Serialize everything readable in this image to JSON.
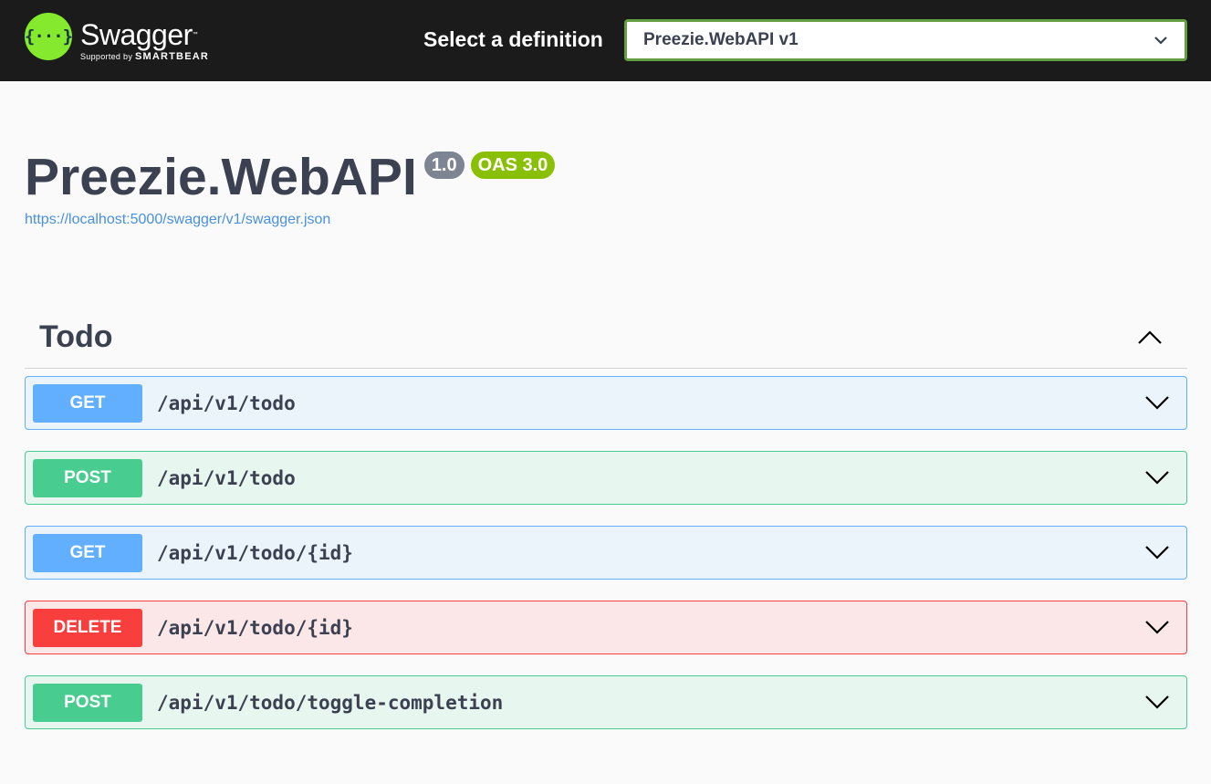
{
  "topbar": {
    "logo_name": "Swagger",
    "logo_trademark": "™",
    "logo_supported": "Supported by",
    "logo_company": "SMARTBEAR",
    "logo_glyph": "{···}",
    "definition_label": "Select a definition",
    "definition_selected": "Preezie.WebAPI v1"
  },
  "info": {
    "title": "Preezie.WebAPI",
    "version": "1.0",
    "oas": "OAS 3.0",
    "spec_url": "https://localhost:5000/swagger/v1/swagger.json"
  },
  "tag": {
    "name": "Todo",
    "expanded_icon": "chevron-up-icon"
  },
  "operations": [
    {
      "method": "GET",
      "path": "/api/v1/todo"
    },
    {
      "method": "POST",
      "path": "/api/v1/todo"
    },
    {
      "method": "GET",
      "path": "/api/v1/todo/{id}"
    },
    {
      "method": "DELETE",
      "path": "/api/v1/todo/{id}"
    },
    {
      "method": "POST",
      "path": "/api/v1/todo/toggle-completion"
    }
  ],
  "colors": {
    "topbar_bg": "#1b1b1b",
    "logo_green": "#85ea2d",
    "get": "#61affe",
    "post": "#49cc90",
    "delete": "#f93e3e",
    "badge_version": "#7d8492",
    "badge_oas": "#89bf04",
    "link": "#4990e2"
  }
}
